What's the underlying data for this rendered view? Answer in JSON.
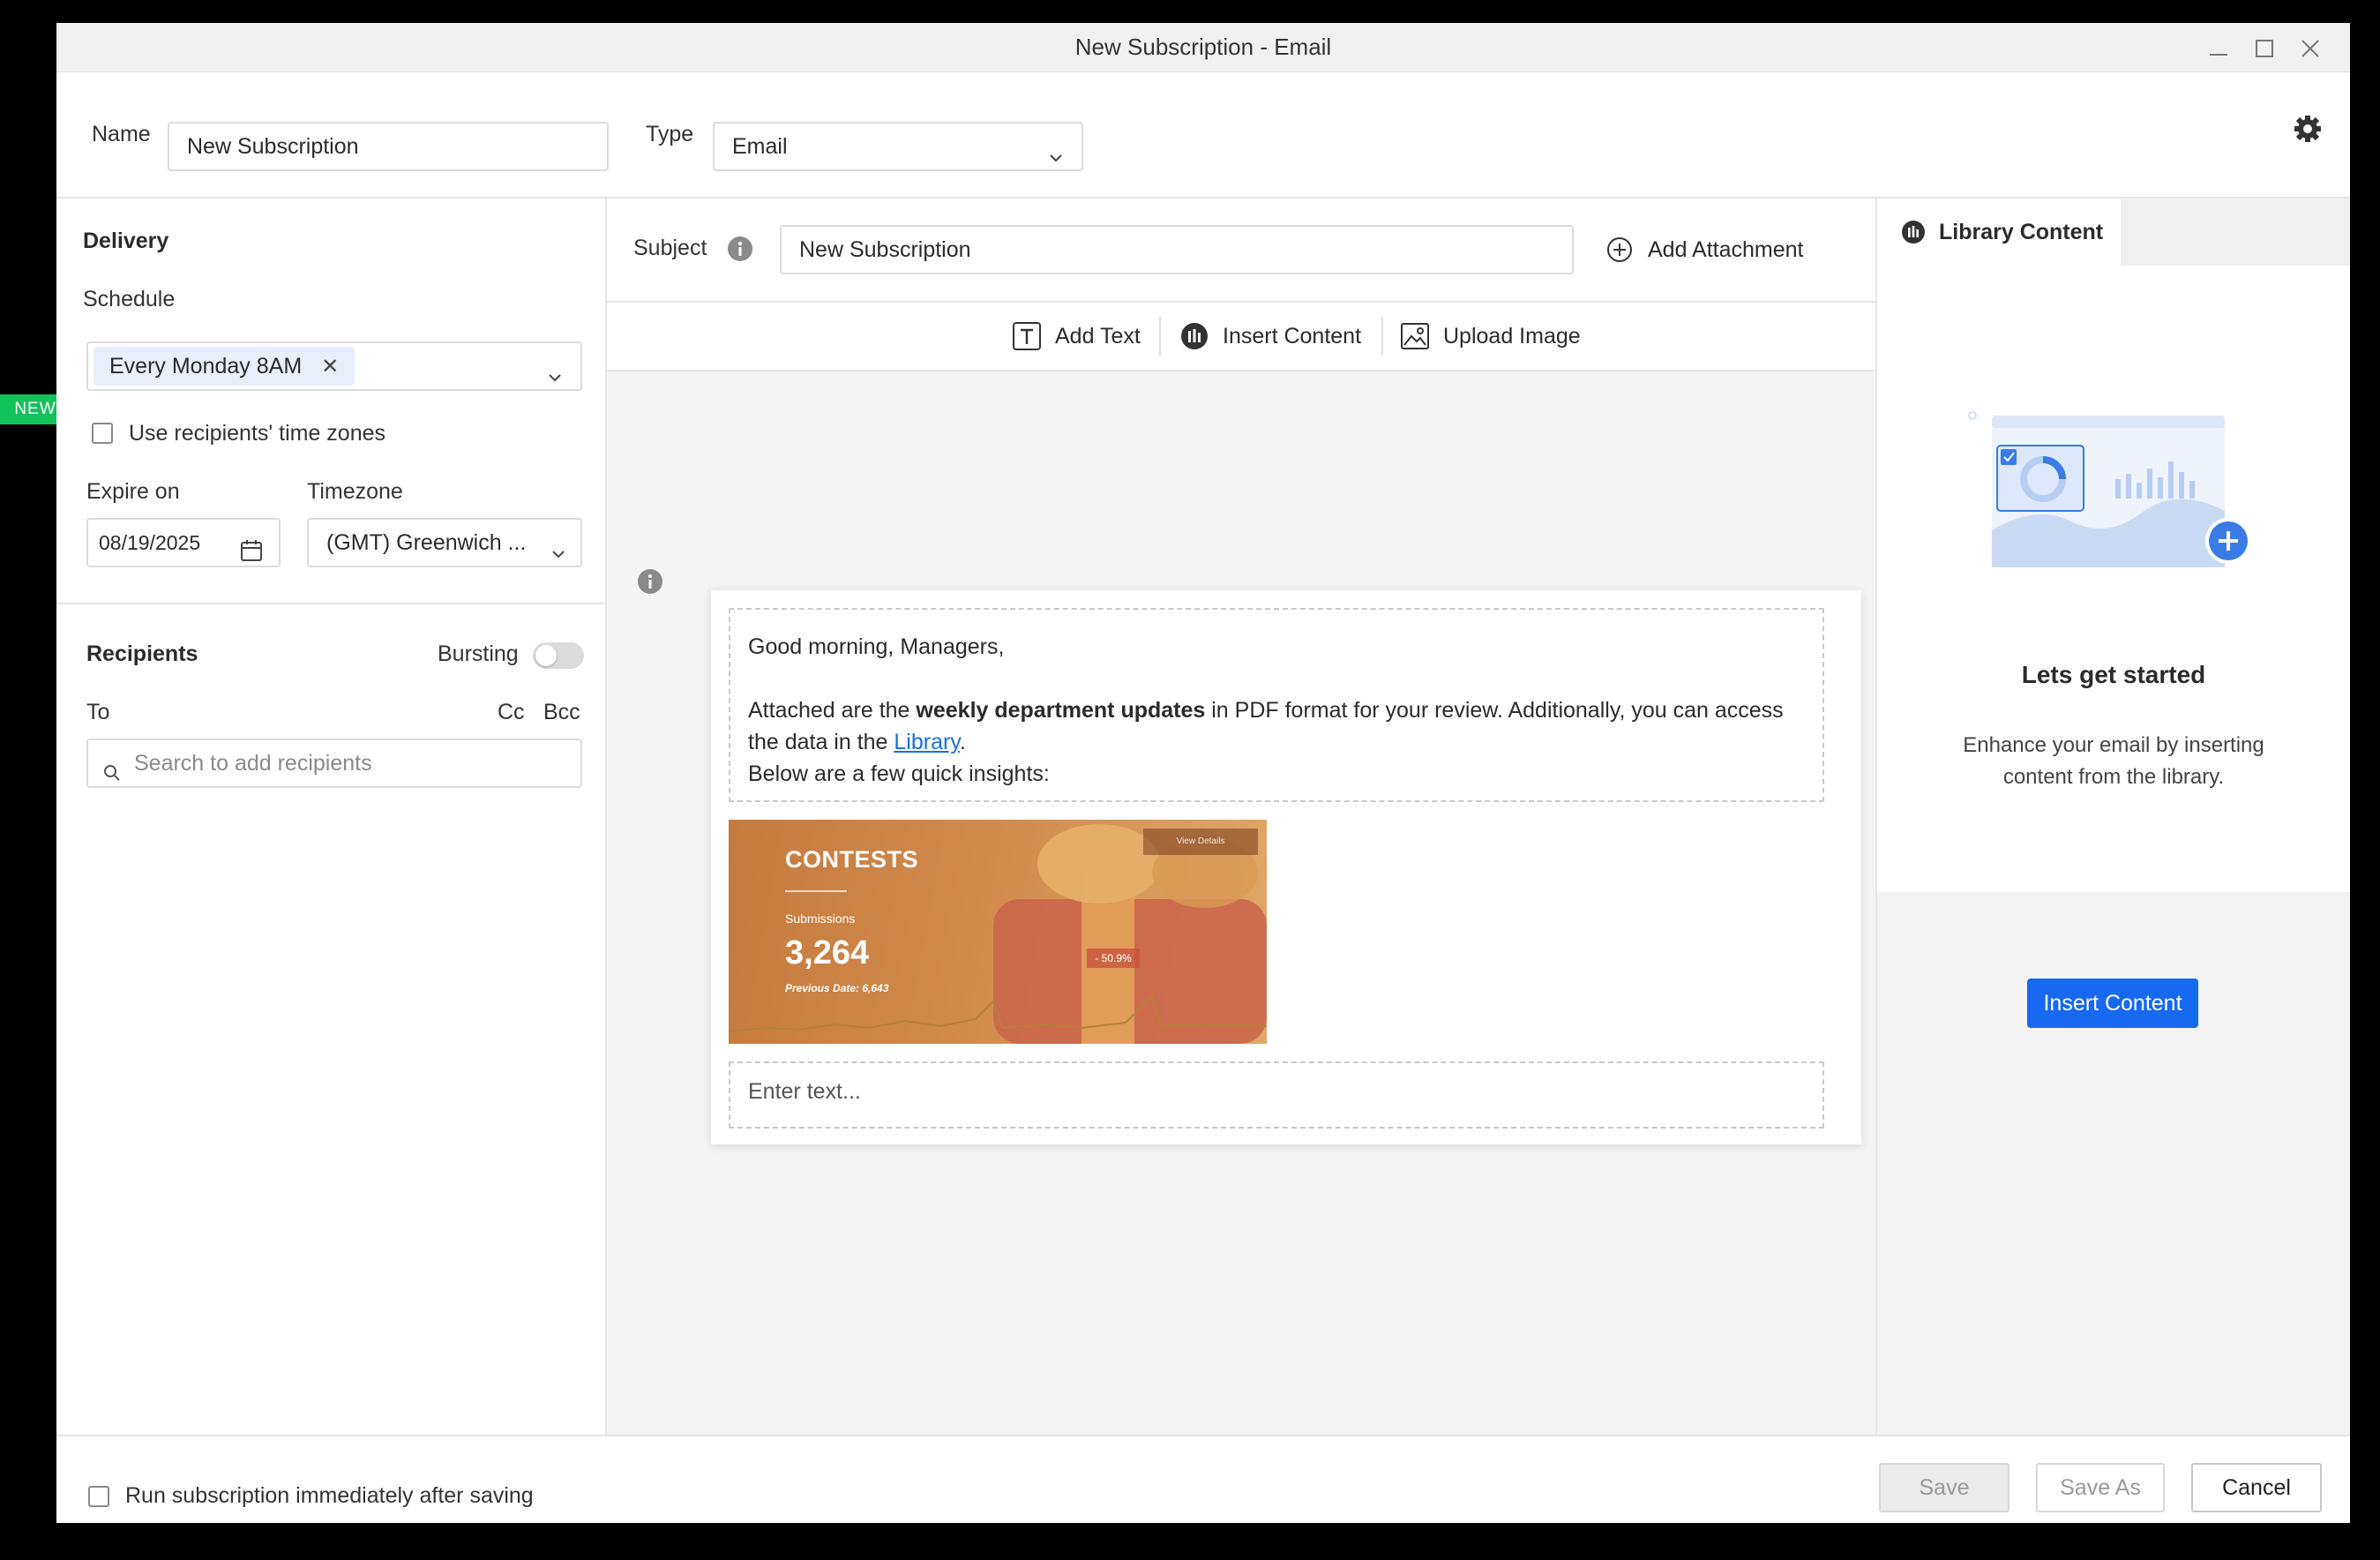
{
  "window": {
    "title": "New Subscription - Email"
  },
  "header": {
    "name_label": "Name",
    "name_value": "New Subscription",
    "type_label": "Type",
    "type_value": "Email"
  },
  "delivery": {
    "title": "Delivery",
    "schedule_label": "Schedule",
    "schedule_chip": "Every Monday 8AM",
    "new_badge": "NEW",
    "use_timezones_label": "Use recipients' time zones",
    "expire_label": "Expire on",
    "expire_value": "08/19/2025",
    "timezone_label": "Timezone",
    "timezone_value": "(GMT) Greenwich ..."
  },
  "recipients": {
    "title": "Recipients",
    "bursting_label": "Bursting",
    "to_label": "To",
    "cc_label": "Cc",
    "bcc_label": "Bcc",
    "search_placeholder": "Search to add recipients"
  },
  "editor": {
    "subject_label": "Subject",
    "subject_value": "New Subscription",
    "add_attachment": "Add Attachment",
    "toolbar": {
      "add_text": "Add Text",
      "insert_content": "Insert Content",
      "upload_image": "Upload Image"
    },
    "body": {
      "greeting": "Good morning, Managers,",
      "line1_pre": "Attached are the ",
      "line1_bold": "weekly department updates",
      "line1_post": " in PDF format for your review. Additionally, you can access",
      "line2_pre": "the data in the ",
      "line2_link": "Library",
      "line2_post": ".",
      "line3": "Below are a few quick insights:"
    },
    "widget": {
      "title": "CONTESTS",
      "subtitle": "Submissions",
      "value": "3,264",
      "previous": "Previous Date: 6,643",
      "button": "View Details",
      "change": "- 50.9%"
    },
    "text_placeholder": "Enter text..."
  },
  "library": {
    "tab_label": "Library Content",
    "heading": "Lets get started",
    "description_line1": "Enhance your email by inserting",
    "description_line2": "content from the library.",
    "insert_button": "Insert Content"
  },
  "footer": {
    "run_immediately_label": "Run subscription immediately after saving",
    "save": "Save",
    "save_as": "Save As",
    "cancel": "Cancel"
  },
  "colors": {
    "accent": "#1769f0",
    "new_badge": "#14c25a",
    "link": "#1a6fe0"
  }
}
